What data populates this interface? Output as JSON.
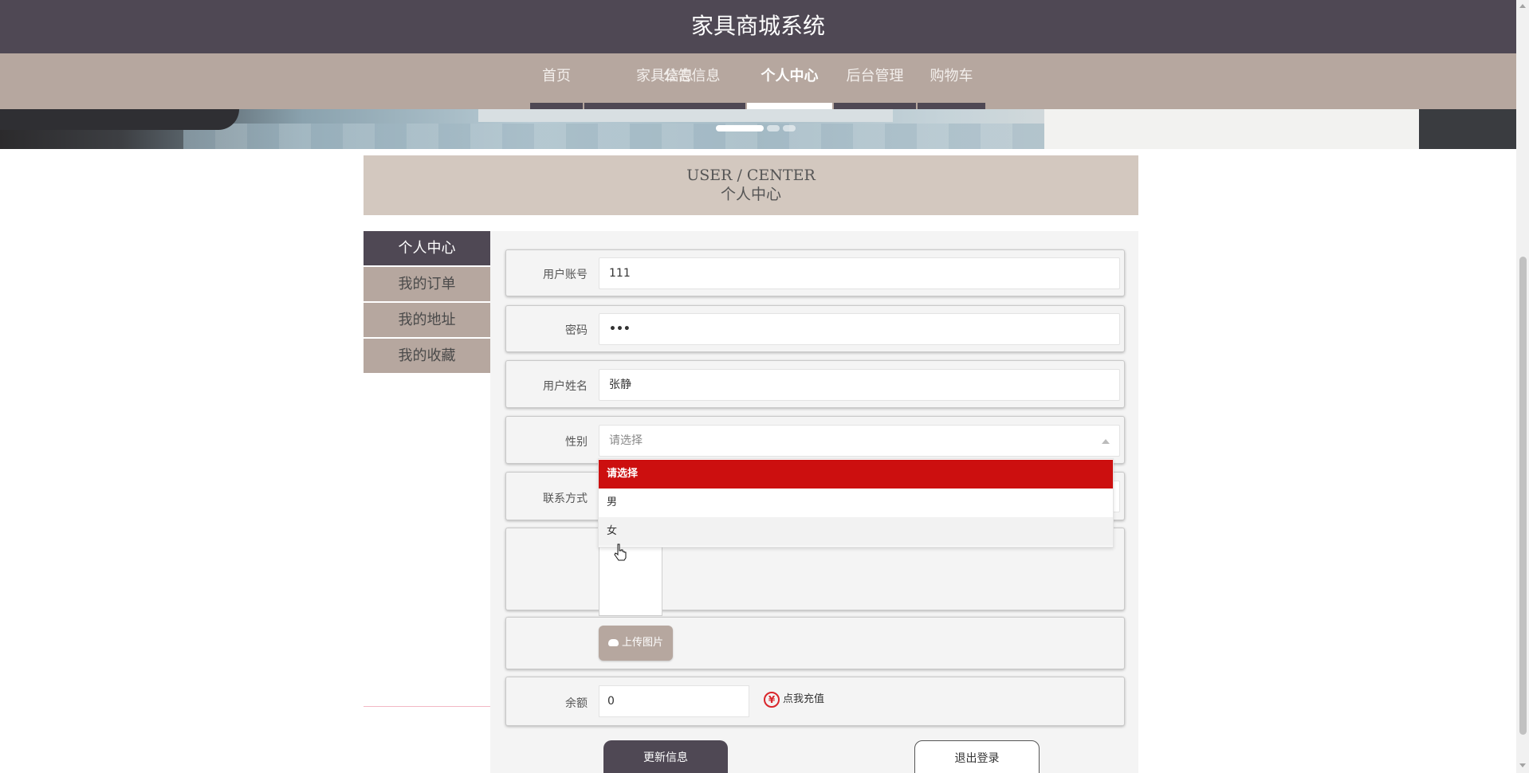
{
  "header": {
    "title": "家具商城系统"
  },
  "nav": {
    "items": [
      {
        "label": "首页"
      },
      {
        "label": "家具信息"
      },
      {
        "label": "公告信息"
      },
      {
        "label": "个人中心",
        "active": true
      },
      {
        "label": "后台管理"
      },
      {
        "label": "购物车"
      }
    ]
  },
  "section": {
    "title_en": "USER / CENTER",
    "title_cn": "个人中心"
  },
  "sidebar": {
    "items": [
      {
        "label": "个人中心",
        "active": true
      },
      {
        "label": "我的订单"
      },
      {
        "label": "我的地址"
      },
      {
        "label": "我的收藏"
      }
    ]
  },
  "form": {
    "account": {
      "label": "用户账号",
      "value": "111"
    },
    "password": {
      "label": "密码",
      "value": "•••"
    },
    "name": {
      "label": "用户姓名",
      "value": "张静"
    },
    "gender": {
      "label": "性别",
      "placeholder": "请选择",
      "options": [
        "请选择",
        "男",
        "女"
      ],
      "highlighted": "请选择",
      "hovered": "女"
    },
    "contact": {
      "label": "联系方式",
      "value": ""
    },
    "upload_label": "上传图片",
    "balance": {
      "label": "余额",
      "value": "0"
    },
    "recharge_label": "点我充值",
    "recharge_icon": "¥"
  },
  "actions": {
    "update_label": "更新信息",
    "logout_label": "退出登录"
  },
  "colors": {
    "title_bar": "#4f4854",
    "nav_bar": "#b6a79f",
    "section_bg": "#d3c8bf",
    "selected_option": "#cc0f0f",
    "recharge_icon": "#d9262b"
  }
}
